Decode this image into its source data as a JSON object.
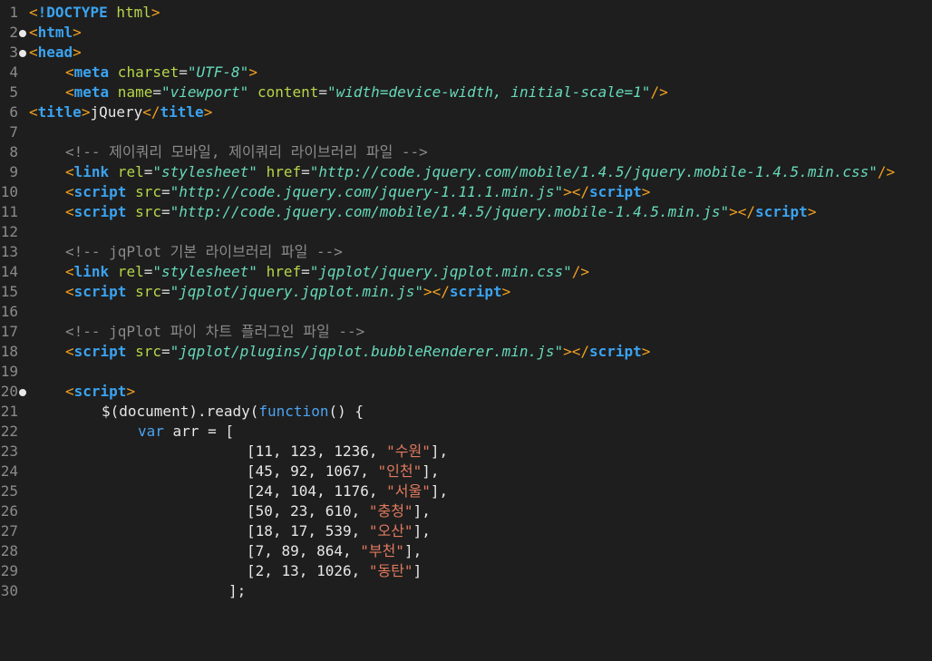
{
  "editor": {
    "lines": [
      {
        "num": "1",
        "parts": [
          "<",
          "!DOCTYPE",
          " html",
          ">"
        ]
      },
      {
        "num": "2",
        "parts": [
          "<",
          "html",
          ">"
        ]
      },
      {
        "num": "3",
        "parts": [
          "<",
          "head",
          ">"
        ]
      },
      {
        "num": "4",
        "parts": [
          "<",
          "meta",
          " charset",
          "=",
          "\"UTF-8\"",
          ">"
        ]
      },
      {
        "num": "5",
        "parts": [
          "<",
          "meta",
          " name",
          "=",
          "\"viewport\"",
          " content",
          "=",
          "\"width=device-width, initial-scale=1\"",
          "/>"
        ]
      },
      {
        "num": "6",
        "parts": [
          "<",
          "title",
          ">",
          "jQuery",
          "</",
          "title",
          ">"
        ]
      },
      {
        "num": "7",
        "parts": []
      },
      {
        "num": "8",
        "parts": [
          "<!-- 제이쿼리 모바일, 제이쿼리 라이브러리 파일 -->"
        ]
      },
      {
        "num": "9",
        "parts": [
          "<",
          "link",
          " rel",
          "=",
          "\"stylesheet\"",
          " href",
          "=",
          "\"http://code.jquery.com/mobile/1.4.5/jquery.mobile-1.4.5.min.css\"",
          "/>"
        ]
      },
      {
        "num": "10",
        "parts": [
          "<",
          "script",
          " src",
          "=",
          "\"http://code.jquery.com/jquery-1.11.1.min.js\"",
          "></",
          "script",
          ">"
        ]
      },
      {
        "num": "11",
        "parts": [
          "<",
          "script",
          " src",
          "=",
          "\"http://code.jquery.com/mobile/1.4.5/jquery.mobile-1.4.5.min.js\"",
          "></",
          "script",
          ">"
        ]
      },
      {
        "num": "12",
        "parts": []
      },
      {
        "num": "13",
        "parts": [
          "<!-- jqPlot 기본 라이브러리 파일 -->"
        ]
      },
      {
        "num": "14",
        "parts": [
          "<",
          "link",
          " rel",
          "=",
          "\"stylesheet\"",
          " href",
          "=",
          "\"jqplot/jquery.jqplot.min.css\"",
          "/>"
        ]
      },
      {
        "num": "15",
        "parts": [
          "<",
          "script",
          " src",
          "=",
          "\"jqplot/jquery.jqplot.min.js\"",
          "></",
          "script",
          ">"
        ]
      },
      {
        "num": "16",
        "parts": []
      },
      {
        "num": "17",
        "parts": [
          "<!-- jqPlot 파이 차트 플러그인 파일 -->"
        ]
      },
      {
        "num": "18",
        "parts": [
          "<",
          "script",
          " src",
          "=",
          "\"jqplot/plugins/jqplot.bubbleRenderer.min.js\"",
          "></",
          "script",
          ">"
        ]
      },
      {
        "num": "19",
        "parts": []
      },
      {
        "num": "20",
        "parts": [
          "<",
          "script",
          ">"
        ]
      },
      {
        "num": "21",
        "parts": [
          "$(document).ready(",
          "function",
          "() {"
        ]
      },
      {
        "num": "22",
        "parts": [
          "var",
          " arr = ["
        ]
      },
      {
        "num": "23",
        "parts": [
          "[11, 123, 1236, ",
          "\"수원\"",
          "],"
        ]
      },
      {
        "num": "24",
        "parts": [
          "[45, 92, 1067, ",
          "\"인천\"",
          "],"
        ]
      },
      {
        "num": "25",
        "parts": [
          "[24, 104, 1176, ",
          "\"서울\"",
          "],"
        ]
      },
      {
        "num": "26",
        "parts": [
          "[50, 23, 610, ",
          "\"충청\"",
          "],"
        ]
      },
      {
        "num": "27",
        "parts": [
          "[18, 17, 539, ",
          "\"오산\"",
          "],"
        ]
      },
      {
        "num": "28",
        "parts": [
          "[7, 89, 864, ",
          "\"부천\"",
          "],"
        ]
      },
      {
        "num": "29",
        "parts": [
          "[2, 13, 1026, ",
          "\"동탄\"",
          "]"
        ]
      },
      {
        "num": "30",
        "parts": [
          "];"
        ]
      }
    ]
  },
  "colors": {
    "background": "#1e1e1e",
    "tag": "#3ba3f0",
    "punct": "#f0a020",
    "attr": "#b5d64a",
    "string": "#66d9b8",
    "comment": "#8a8a8a",
    "js_string": "#e07a5f"
  }
}
